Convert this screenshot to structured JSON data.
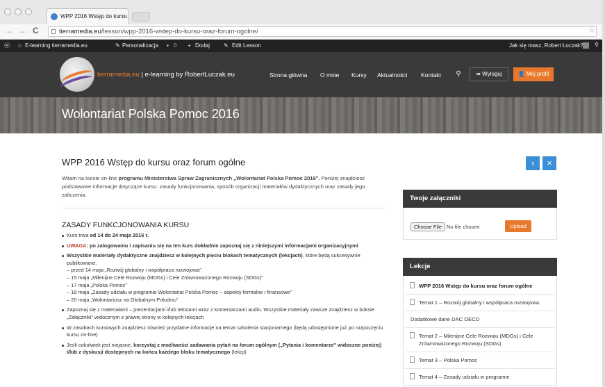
{
  "browser": {
    "tab_title": "WPP 2016 Wstęp do kursu",
    "tab_close": "×",
    "url_domain": "tierramedia.eu",
    "url_path": "/lesson/wpp-2016-wstep-do-kursu-oraz-forum-ogolne/",
    "back": "←",
    "forward": "→",
    "reload": "C",
    "star": "☆"
  },
  "adminbar": {
    "wp_logo": "ⓦ",
    "site": "E-learning tierramedia.eu",
    "customize": "Personalizacja",
    "comments": "0",
    "add": "Dodaj",
    "edit": "Edit Lesson",
    "greeting": "Jak się masz, Robert Łuczak?",
    "search_glyph": "🔍"
  },
  "header": {
    "site_highlight": "tierramedia.eu",
    "site_rest": " | e-learning by RobertLuczak.eu",
    "menu": [
      "Strona główna",
      "O mnie",
      "Kursy",
      "Aktualności",
      "Kontakt"
    ],
    "logout": "Wyloguj",
    "profile": "Mój profil"
  },
  "hero": {
    "title": "Wolontariat Polska Pomoc 2016"
  },
  "lesson": {
    "title": "WPP 2016 Wstęp do kursu oraz forum ogólne",
    "next_icon": "›",
    "close_icon": "×",
    "intro_1": "Witam na kursie on-line ",
    "intro_bold": "programu Ministerstwa Spraw Zagranicznych „Wolontariat Polska Pomoc 2016\".",
    "intro_2": " Poniżej znajdziesz podstawowe informacje dotyczące kursu: zasady funkcjonowania, sposób organizacji materiałów dydaktycznych oraz zasady jego zaliczenia.",
    "section_title": "ZASADY FUNKCJONOWANIA KURSU",
    "rule1_a": "Kurs trwa ",
    "rule1_b": "od 14 do 24 maja 2016 r.",
    "rule2_red": "UWAGA",
    "rule2_b": ": po zalogowaniu i zapisaniu się na ten kurs dokładnie zapoznaj się z niniejszymi informacjami organizacyjnymi",
    "rule3_b": "Wszystkie materiały dydaktyczne znajdziesz w kolejnych pięciu blokach tematycznych (lekcjach)",
    "rule3_a": ", które będą sukcesywnie publikowane:",
    "rule3_lines": [
      "– przed 14 maja „Rozwój globalny i współpraca rozwojowa\"",
      "– 15 maja „Milenijne Cele Rozwoju (MDGs) i Cele Zrównoważonego Rozwoju (SDGs)\"",
      "– 17 maja „Polska Pomoc\"",
      "– 18 maja „Zasady udziału w programie Wolontariat Polska Pomoc – aspekty formalne i finansowe\"",
      "– 20 maja „Wolontariusz na Globalnym Południu\""
    ],
    "rule4": "Zapoznaj się z materiałami – prezentacjami i/lub tekstami wraz z komentarzami audio. Wszystkie materiały zawsze znajdziesz w boksie „Załączniki\" widocznym z prawej strony w kolejnych lekcjach",
    "rule5": "W zasobach kursowych znajdziesz również przydatne informacje na temat szkolenia stacjonarnego (będą udostępnione już po rozpoczęciu kursu on-line)",
    "rule6_a": "Jeśli cokolwiek jest niejasne, ",
    "rule6_b": "korzystaj z możliwości zadawania pytań na forum ogólnym („Pytania i komentarze\" widoczne poniżej) i/lub z dyskusji dostępnych na końcu każdego bloku tematycznego",
    "rule6_c": " (lekcji)"
  },
  "sidebar": {
    "attach_title": "Twoje załączniki",
    "choose_file": "Choose File",
    "no_file": "No file chosen",
    "upload": "Upload",
    "lessons_title": "Lekcje",
    "lessons": [
      "WPP 2016 Wstęp do kursu oraz forum ogólne",
      "Temat 1 – Rozwój globalny i współpraca rozwojowa",
      "Dodatkowe dane DAC OECD",
      "Temat 2 – Milenijne Cele Rozwoju (MDGs) i Cele Zrównoważonego Rozwoju (SDGs)",
      "Temat 3 – Polska Pomoc",
      "Temat 4 – Zasady udziału w programie"
    ]
  }
}
